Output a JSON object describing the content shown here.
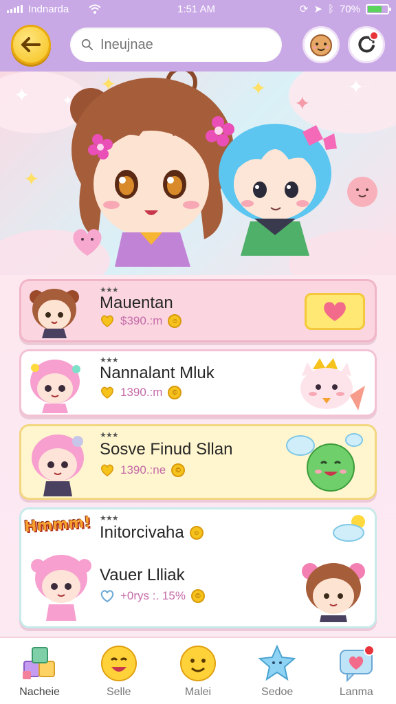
{
  "status_bar": {
    "carrier": "Indnarda",
    "time": "1:51 AM",
    "battery": "70%",
    "battery_level": 0.7
  },
  "header": {
    "search_placeholder": "Ineujnae"
  },
  "cards": [
    {
      "stars": "★★★",
      "title": "Mauentan",
      "meta_text": "$390.:m"
    },
    {
      "stars": "★★★",
      "title": "Nannalant Mluk",
      "meta_text": "1390.:m"
    },
    {
      "stars": "★★★",
      "title": "Sosve Finud Sllan",
      "meta_text": "1390.:ne"
    },
    {
      "stars": "★★★",
      "title": "Initorcivaha",
      "logo_text": "Hmmm!",
      "subtitle": "Vauer Llliak",
      "meta_text": "+0rys :. 15%"
    }
  ],
  "bottom_nav": [
    {
      "label": "Nacheie",
      "icon": "blocks-icon"
    },
    {
      "label": "Selle",
      "icon": "smile-icon"
    },
    {
      "label": "Malei",
      "icon": "smile-icon"
    },
    {
      "label": "Sedoe",
      "icon": "star-creature-icon"
    },
    {
      "label": "Lanma",
      "icon": "chat-heart-icon"
    }
  ],
  "colors": {
    "header_bg": "#c9a8e6",
    "accent_yellow": "#f6c21c",
    "pink": "#f1b5c8"
  }
}
